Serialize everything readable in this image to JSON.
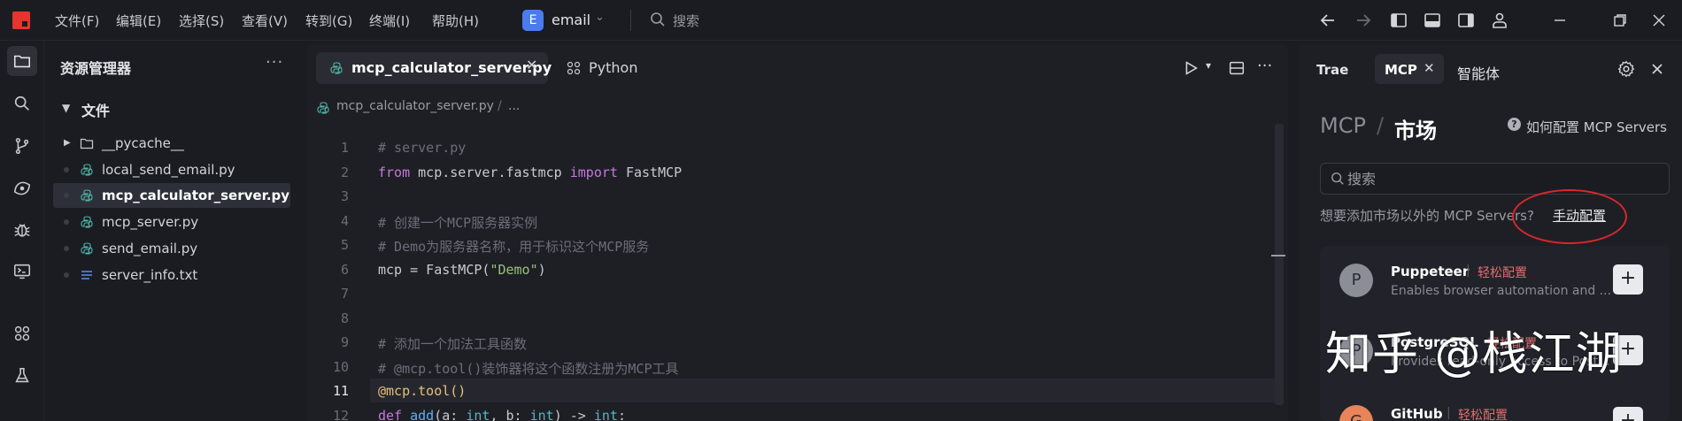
{
  "titlebar": {
    "menu": [
      "文件(F)",
      "编辑(E)",
      "选择(S)",
      "查看(V)",
      "转到(G)",
      "终端(I)",
      "帮助(H)"
    ],
    "project_badge": "E",
    "project_name": "email",
    "search_label": "搜索"
  },
  "explorer": {
    "title": "资源管理器",
    "more": "···",
    "folder_label": "文件",
    "files": [
      {
        "name": "__pycache__",
        "type": "folder"
      },
      {
        "name": "local_send_email.py",
        "type": "python"
      },
      {
        "name": "mcp_calculator_server.py",
        "type": "python",
        "selected": true
      },
      {
        "name": "mcp_server.py",
        "type": "python"
      },
      {
        "name": "send_email.py",
        "type": "python"
      },
      {
        "name": "server_info.txt",
        "type": "text"
      }
    ]
  },
  "editor": {
    "active_tab": "mcp_calculator_server.py",
    "tab_close": "✕",
    "second_tab": "Python",
    "breadcrumb_file": "mcp_calculator_server.py",
    "breadcrumb_sep": "/",
    "breadcrumb_more": "...",
    "current_line": 11,
    "line_numbers": [
      "1",
      "2",
      "3",
      "4",
      "5",
      "6",
      "7",
      "8",
      "9",
      "10",
      "11",
      "12"
    ],
    "code": [
      [
        {
          "t": "# server.py",
          "c": "com"
        }
      ],
      [
        {
          "t": "from",
          "c": "kw"
        },
        {
          "t": " mcp.server.fastmcp ",
          "c": "op"
        },
        {
          "t": "import",
          "c": "kw"
        },
        {
          "t": " FastMCP",
          "c": "op"
        }
      ],
      [],
      [
        {
          "t": "# 创建一个MCP服务器实例",
          "c": "com"
        }
      ],
      [
        {
          "t": "# Demo为服务器名称，用于标识这个MCP服务",
          "c": "com"
        }
      ],
      [
        {
          "t": "mcp = FastMCP(",
          "c": "op"
        },
        {
          "t": "\"Demo\"",
          "c": "str"
        },
        {
          "t": ")",
          "c": "op"
        }
      ],
      [],
      [],
      [
        {
          "t": "# 添加一个加法工具函数",
          "c": "com"
        }
      ],
      [
        {
          "t": "# @mcp.tool()装饰器将这个函数注册为MCP工具",
          "c": "com"
        }
      ],
      [
        {
          "t": "@mcp.tool()",
          "c": "dec"
        }
      ],
      [
        {
          "t": "def",
          "c": "kw"
        },
        {
          "t": " ",
          "c": "op"
        },
        {
          "t": "add",
          "c": "fn"
        },
        {
          "t": "(a: ",
          "c": "op"
        },
        {
          "t": "int",
          "c": "type"
        },
        {
          "t": ", b: ",
          "c": "op"
        },
        {
          "t": "int",
          "c": "type"
        },
        {
          "t": ") -> ",
          "c": "op"
        },
        {
          "t": "int",
          "c": "type"
        },
        {
          "t": ":",
          "c": "op"
        }
      ]
    ]
  },
  "right_panel": {
    "tabs": {
      "trae": "Trae",
      "mcp": "MCP",
      "mcp_close": "✕",
      "agent": "智能体"
    },
    "title_a": "MCP",
    "title_slash": "/",
    "title_b": "市场",
    "help_icon": "?",
    "help_text": "如何配置 MCP Servers",
    "search_placeholder": "搜索",
    "manual_question": "想要添加市场以外的 MCP Servers?",
    "manual_link": "手动配置",
    "servers": [
      {
        "avatar": "P",
        "name": "Puppeteer",
        "tag": "轻松配置",
        "desc": "Enables browser automation and ..."
      },
      {
        "avatar": "P",
        "name": "PostgreSQL",
        "tag": "轻松配置",
        "desc": "Provides read-only access to Post..."
      },
      {
        "avatar": "G",
        "name": "GitHub",
        "tag": "轻松配置",
        "desc": ""
      }
    ],
    "add_label": "+"
  },
  "watermark": "知乎 @栈江湖",
  "colors": {
    "accent_red": "#d8282c",
    "tag_red": "#e26d6d",
    "project_blue": "#4a7cf0"
  }
}
